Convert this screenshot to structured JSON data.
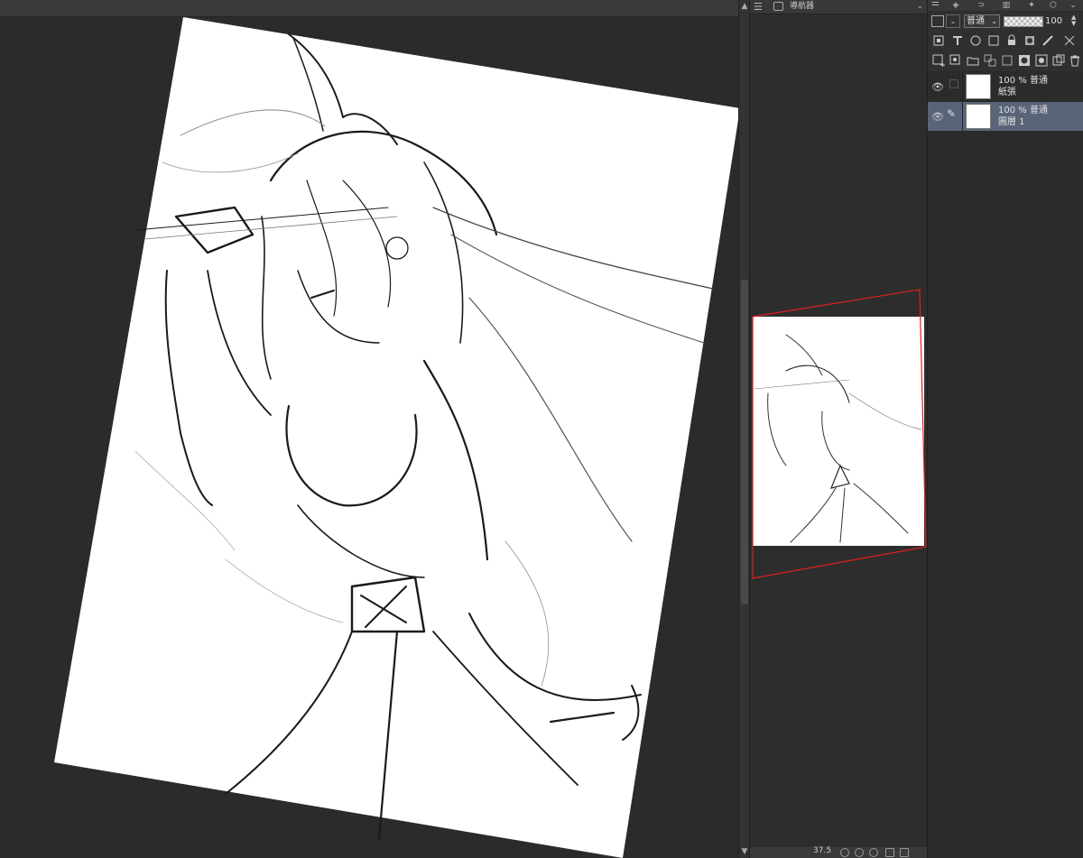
{
  "navigator": {
    "title": "導航器",
    "menu_icon": "menu-icon",
    "zoom_value": "37.5"
  },
  "layer_panel": {
    "blend_mode": "普通",
    "opacity": "100",
    "layers": [
      {
        "opacity_blend": "100 % 普通",
        "name": "紙張",
        "selected": false
      },
      {
        "opacity_blend": "100 % 普通",
        "name": "圖層 1",
        "selected": true
      }
    ]
  },
  "colors": {
    "canvas_bg": "#2b2b2b",
    "paper": "#ffffff",
    "selected_layer": "#5a6478",
    "nav_frame": "#e02020"
  }
}
